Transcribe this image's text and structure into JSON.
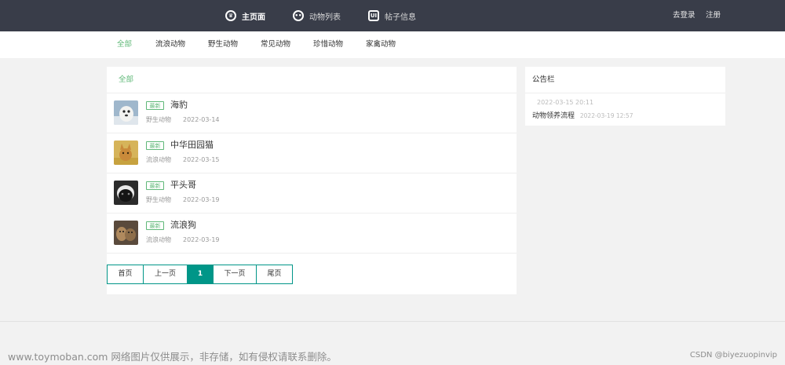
{
  "topnav": {
    "home": "主页面",
    "animals": "动物列表",
    "posts": "帖子信息",
    "login": "去登录",
    "register": "注册"
  },
  "subnav": [
    "全部",
    "流浪动物",
    "野生动物",
    "常见动物",
    "珍惜动物",
    "家禽动物"
  ],
  "main": {
    "heading": "全部",
    "badge": "最新",
    "items": [
      {
        "title": "海豹",
        "category": "野生动物",
        "date": "2022-03-14"
      },
      {
        "title": "中华田园猫",
        "category": "流浪动物",
        "date": "2022-03-15"
      },
      {
        "title": "平头哥",
        "category": "野生动物",
        "date": "2022-03-19"
      },
      {
        "title": "流浪狗",
        "category": "流浪动物",
        "date": "2022-03-19"
      }
    ],
    "pager": {
      "first": "首页",
      "prev": "上一页",
      "current": "1",
      "next": "下一页",
      "last": "尾页"
    }
  },
  "notice": {
    "heading": "公告栏",
    "entries": [
      {
        "title": "",
        "date": "2022-03-15 20:11"
      },
      {
        "title": "动物领养流程",
        "date": "2022-03-19 12:57"
      }
    ]
  },
  "watermark": "www.toymoban.com 网络图片仅供展示，非存储，如有侵权请联系删除。",
  "credit": "CSDN @biyezuopinvip",
  "colors": {
    "topbar": "#393d49",
    "accent": "#5fb878",
    "pager_border": "#009688"
  }
}
